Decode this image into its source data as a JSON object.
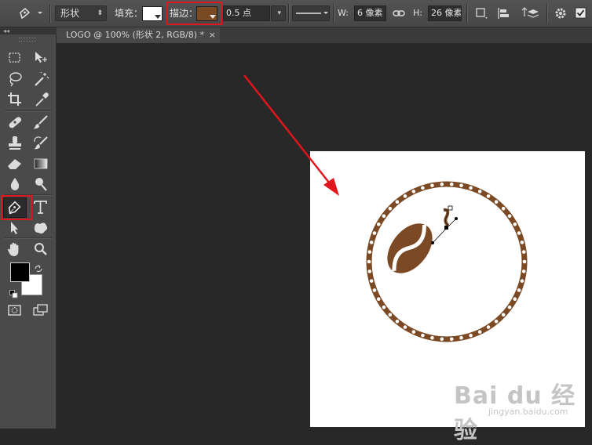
{
  "options_bar": {
    "tool_mode": "形状",
    "fill_label": "填充：",
    "stroke_label": "描边：",
    "stroke_width": "0.5 点",
    "w_label": "W:",
    "w_value": "6 像素",
    "h_label": "H:",
    "h_value": "26 像素"
  },
  "document_tab": {
    "title": "LOGO @ 100% (形状 2, RGB/8) *",
    "close": "×"
  },
  "toolbar": {
    "collapse": "◂◂",
    "selected_tool": "pen-tool"
  },
  "colors": {
    "stroke_swatch": "#7a4a22",
    "fill_swatch": "#ffffff",
    "foreground": "#000000",
    "background": "#ffffff",
    "artwork_brown": "#7b4a24",
    "highlight_red": "#e0161c"
  },
  "watermark": {
    "brand": "Bai du 经验",
    "url": "jingyan.baidu.com"
  }
}
